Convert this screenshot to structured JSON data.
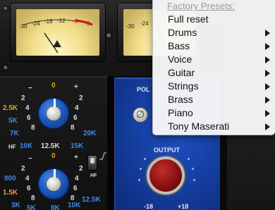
{
  "meters": {
    "left_scale": [
      "-30",
      "-24",
      "-18",
      "-12",
      "-6",
      "0"
    ],
    "right_scale": [
      "-30",
      "-24"
    ]
  },
  "eq": {
    "knob1_ticks": {
      "left_minus": "−",
      "center": "0",
      "right_plus": "+",
      "l2": "2",
      "r2": "2",
      "l4": "4",
      "r4": "4",
      "l6": "6",
      "r6": "6",
      "l8": "8",
      "r8": "8"
    },
    "knob1_freqs": {
      "f1": "2.5K",
      "f2": "5K",
      "f3": "7K",
      "f4": "10K",
      "f5": "12.5K",
      "f6": "15K",
      "f7": "20K",
      "hf": "HF"
    },
    "knob2_ticks": {
      "left_minus": "−",
      "center": "0",
      "right_plus": "+",
      "l2": "2",
      "r2": "2",
      "l4": "4",
      "r4": "4",
      "l6": "6",
      "r6": "6",
      "l8": "8",
      "r8": "8"
    },
    "knob2_freqs": {
      "f1": "800",
      "f2": "1.5K",
      "f3": "3K",
      "f4": "5K",
      "f5": "8K",
      "f6": "10K",
      "f7": "12.5K"
    },
    "hf_switch_label": "HF"
  },
  "output": {
    "pol_label": "POL",
    "pol_symbol": "∅",
    "output_label": "OUTPUT",
    "scale_min": "-18",
    "scale_max": "+18"
  },
  "menu": {
    "header": "Factory Presets:",
    "items": [
      {
        "label": "Full reset",
        "submenu": false
      },
      {
        "label": "Drums",
        "submenu": true
      },
      {
        "label": "Bass",
        "submenu": true
      },
      {
        "label": "Voice",
        "submenu": true
      },
      {
        "label": "Guitar",
        "submenu": true
      },
      {
        "label": "Strings",
        "submenu": true
      },
      {
        "label": "Brass",
        "submenu": true
      },
      {
        "label": "Piano",
        "submenu": true
      },
      {
        "label": "Tony Maserati",
        "submenu": true
      }
    ]
  },
  "colors": {
    "freq_white": "#dcdcdc",
    "freq_blue": "#3f8ae6",
    "freq_orange": "#f0a41a",
    "output_panel": "#153ea0",
    "output_knob": "#8a1010"
  }
}
